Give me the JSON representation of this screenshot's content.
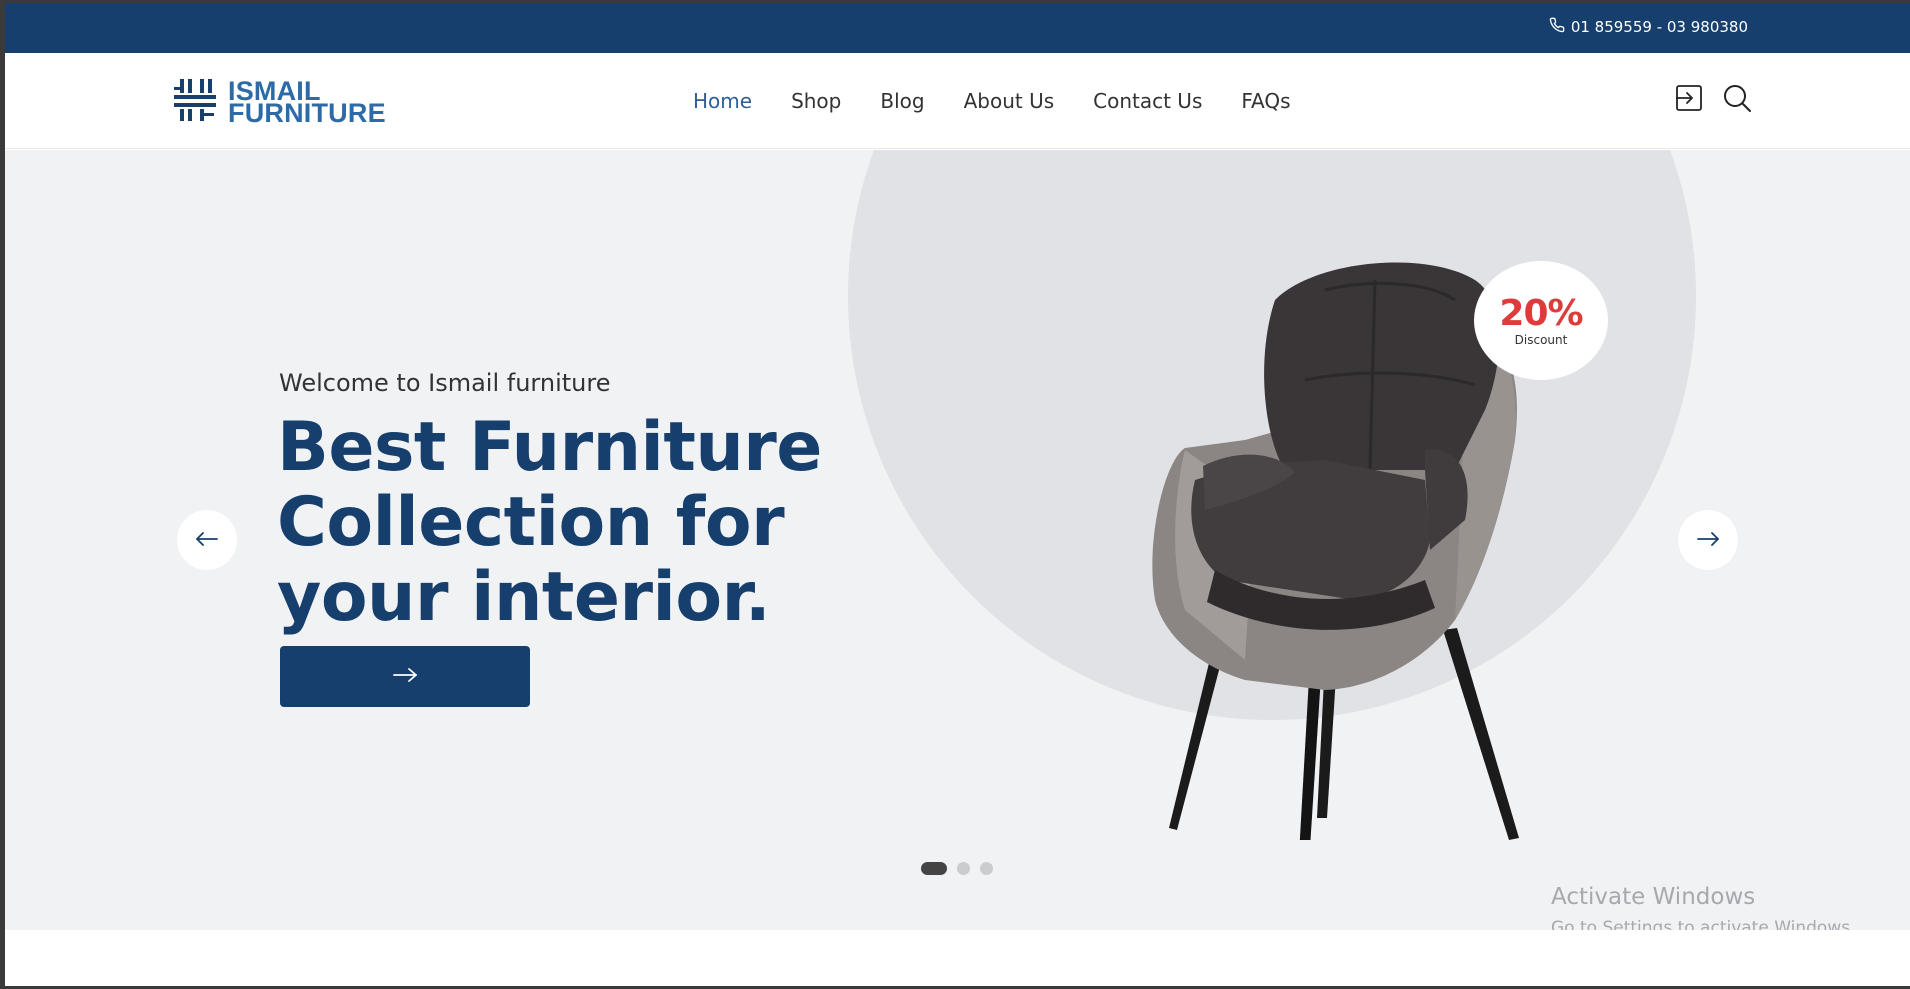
{
  "topbar": {
    "phone_icon": "phone-icon",
    "phone": "01 859559 - 03 980380",
    "background": "#163f6d"
  },
  "header": {
    "logo": {
      "line1": "ISMAIL",
      "line2": "FURNITURE",
      "color": "#2d6aa8"
    },
    "nav": [
      {
        "label": "Home",
        "active": true
      },
      {
        "label": "Shop"
      },
      {
        "label": "Blog"
      },
      {
        "label": "About Us"
      },
      {
        "label": "Contact Us"
      },
      {
        "label": "FAQs"
      }
    ],
    "icons": [
      "login-icon",
      "search-icon"
    ]
  },
  "hero": {
    "welcome": "Welcome to Ismail furniture",
    "headline": "Best Furniture Collection for your interior.",
    "cta_icon": "arrow-right-icon",
    "badge": {
      "value": "20%",
      "label": "Discount",
      "color": "#e03b3b"
    },
    "slides": {
      "count": 3,
      "active": 1
    },
    "prev_icon": "arrow-left-icon",
    "next_icon": "arrow-right-icon",
    "background": "#f0f2f4"
  },
  "watermark": {
    "title": "Activate Windows",
    "subtitle": "Go to Settings to activate Windows."
  }
}
